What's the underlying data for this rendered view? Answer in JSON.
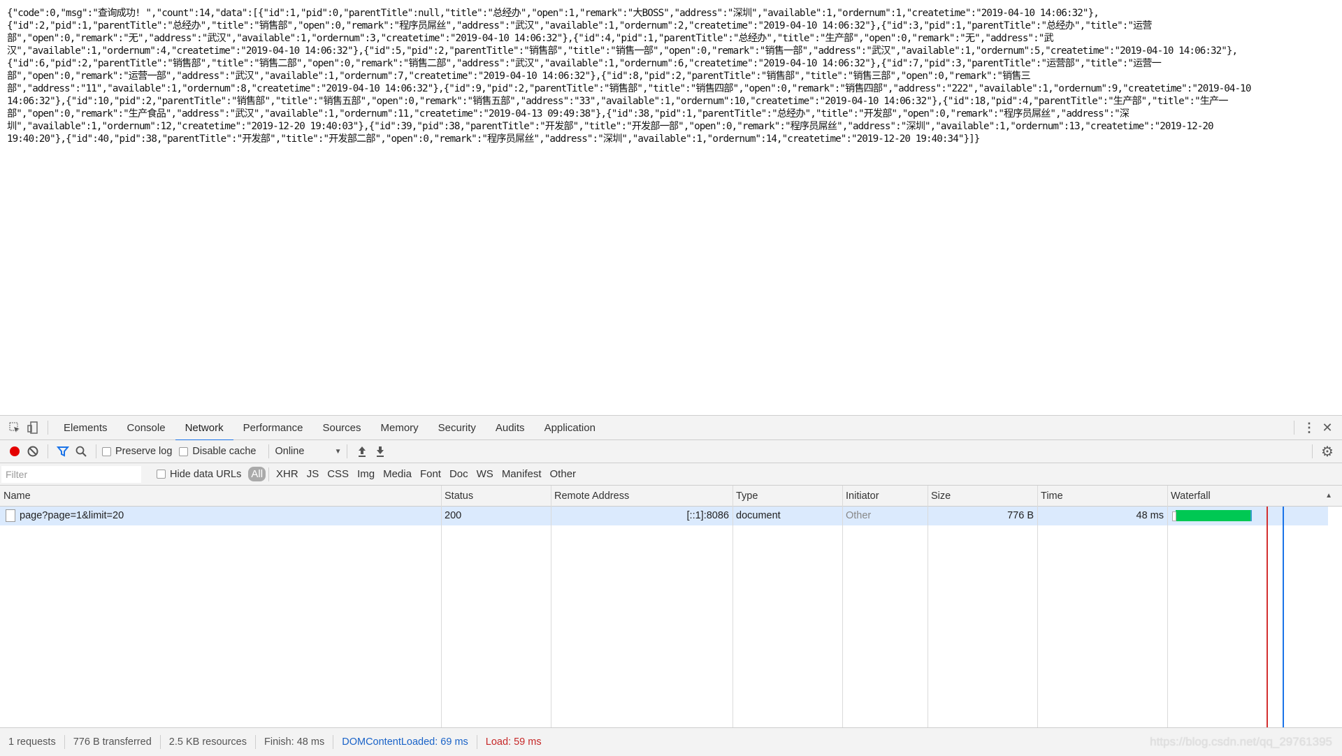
{
  "page": {
    "json_lines": [
      "{\"code\":0,\"msg\":\"查询成功! \",\"count\":14,\"data\":[{\"id\":1,\"pid\":0,\"parentTitle\":null,\"title\":\"总经办\",\"open\":1,\"remark\":\"大BOSS\",\"address\":\"深圳\",\"available\":1,\"ordernum\":1,\"createtime\":\"2019-04-10 14:06:32\"},",
      "{\"id\":2,\"pid\":1,\"parentTitle\":\"总经办\",\"title\":\"销售部\",\"open\":0,\"remark\":\"程序员屌丝\",\"address\":\"武汉\",\"available\":1,\"ordernum\":2,\"createtime\":\"2019-04-10 14:06:32\"},{\"id\":3,\"pid\":1,\"parentTitle\":\"总经办\",\"title\":\"运营",
      "部\",\"open\":0,\"remark\":\"无\",\"address\":\"武汉\",\"available\":1,\"ordernum\":3,\"createtime\":\"2019-04-10 14:06:32\"},{\"id\":4,\"pid\":1,\"parentTitle\":\"总经办\",\"title\":\"生产部\",\"open\":0,\"remark\":\"无\",\"address\":\"武",
      "汉\",\"available\":1,\"ordernum\":4,\"createtime\":\"2019-04-10 14:06:32\"},{\"id\":5,\"pid\":2,\"parentTitle\":\"销售部\",\"title\":\"销售一部\",\"open\":0,\"remark\":\"销售一部\",\"address\":\"武汉\",\"available\":1,\"ordernum\":5,\"createtime\":\"2019-04-10 14:06:32\"},",
      "{\"id\":6,\"pid\":2,\"parentTitle\":\"销售部\",\"title\":\"销售二部\",\"open\":0,\"remark\":\"销售二部\",\"address\":\"武汉\",\"available\":1,\"ordernum\":6,\"createtime\":\"2019-04-10 14:06:32\"},{\"id\":7,\"pid\":3,\"parentTitle\":\"运营部\",\"title\":\"运营一",
      "部\",\"open\":0,\"remark\":\"运营一部\",\"address\":\"武汉\",\"available\":1,\"ordernum\":7,\"createtime\":\"2019-04-10 14:06:32\"},{\"id\":8,\"pid\":2,\"parentTitle\":\"销售部\",\"title\":\"销售三部\",\"open\":0,\"remark\":\"销售三",
      "部\",\"address\":\"11\",\"available\":1,\"ordernum\":8,\"createtime\":\"2019-04-10 14:06:32\"},{\"id\":9,\"pid\":2,\"parentTitle\":\"销售部\",\"title\":\"销售四部\",\"open\":0,\"remark\":\"销售四部\",\"address\":\"222\",\"available\":1,\"ordernum\":9,\"createtime\":\"2019-04-10",
      "14:06:32\"},{\"id\":10,\"pid\":2,\"parentTitle\":\"销售部\",\"title\":\"销售五部\",\"open\":0,\"remark\":\"销售五部\",\"address\":\"33\",\"available\":1,\"ordernum\":10,\"createtime\":\"2019-04-10 14:06:32\"},{\"id\":18,\"pid\":4,\"parentTitle\":\"生产部\",\"title\":\"生产一",
      "部\",\"open\":0,\"remark\":\"生产食品\",\"address\":\"武汉\",\"available\":1,\"ordernum\":11,\"createtime\":\"2019-04-13 09:49:38\"},{\"id\":38,\"pid\":1,\"parentTitle\":\"总经办\",\"title\":\"开发部\",\"open\":0,\"remark\":\"程序员屌丝\",\"address\":\"深",
      "圳\",\"available\":1,\"ordernum\":12,\"createtime\":\"2019-12-20 19:40:03\"},{\"id\":39,\"pid\":38,\"parentTitle\":\"开发部\",\"title\":\"开发部一部\",\"open\":0,\"remark\":\"程序员屌丝\",\"address\":\"深圳\",\"available\":1,\"ordernum\":13,\"createtime\":\"2019-12-20",
      "19:40:20\"},{\"id\":40,\"pid\":38,\"parentTitle\":\"开发部\",\"title\":\"开发部二部\",\"open\":0,\"remark\":\"程序员屌丝\",\"address\":\"深圳\",\"available\":1,\"ordernum\":14,\"createtime\":\"2019-12-20 19:40:34\"}]}"
    ]
  },
  "devtools": {
    "tabs": [
      "Elements",
      "Console",
      "Network",
      "Performance",
      "Sources",
      "Memory",
      "Security",
      "Audits",
      "Application"
    ],
    "active_tab": "Network",
    "icons": {
      "inspect": "inspect-element-icon",
      "device": "device-toolbar-icon",
      "more": "more-vertical-icon",
      "close": "close-icon",
      "record": "record-icon",
      "clear": "clear-icon",
      "filter": "filter-icon",
      "search": "search-icon",
      "import": "import-har-icon",
      "export": "export-har-icon",
      "settings": "gear-icon"
    },
    "toolbar": {
      "preserve_log": "Preserve log",
      "disable_cache": "Disable cache",
      "throttling": "Online",
      "preserve_log_checked": false,
      "disable_cache_checked": false
    },
    "filterbar": {
      "placeholder": "Filter",
      "value": "",
      "hide_data_urls": "Hide data URLs",
      "types": [
        "All",
        "XHR",
        "JS",
        "CSS",
        "Img",
        "Media",
        "Font",
        "Doc",
        "WS",
        "Manifest",
        "Other"
      ],
      "active_type": "All"
    },
    "table": {
      "columns": [
        "Name",
        "Status",
        "Remote Address",
        "Type",
        "Initiator",
        "Size",
        "Time",
        "Waterfall"
      ],
      "rows": [
        {
          "name": "page?page=1&limit=20",
          "status": "200",
          "remote_address": "[::1]:8086",
          "type": "document",
          "initiator": "Other",
          "size": "776 B",
          "time": "48 ms"
        }
      ]
    },
    "statusbar": {
      "requests": "1 requests",
      "transferred": "776 B transferred",
      "resources": "2.5 KB resources",
      "finish": "Finish: 48 ms",
      "dom_content_loaded": "DOMContentLoaded: 69 ms",
      "load": "Load: 59 ms"
    },
    "colors": {
      "accent": "#1a73e8",
      "record": "#e40000",
      "waterfall_bar": "#00c853",
      "dcl_line": "#1a73e8",
      "load_line": "#d32f2f",
      "selected_row": "#dbeafd"
    }
  },
  "watermark": "https://blog.csdn.net/qq_29761395"
}
